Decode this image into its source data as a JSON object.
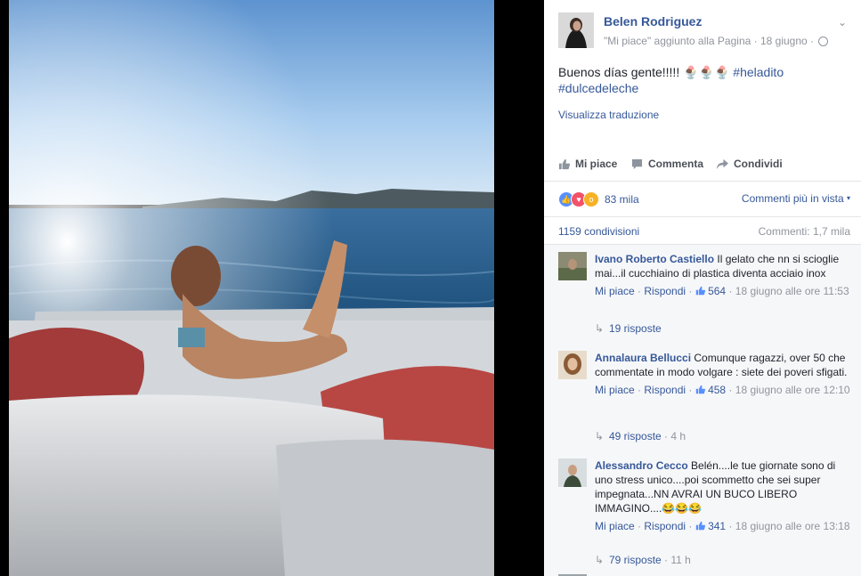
{
  "post": {
    "author": "Belen Rodriguez",
    "meta": "\"Mi piace\" aggiunto alla Pagina · 18 giugno ·",
    "text": "Buenos días gente!!!!! 🍨🍨🍨 ",
    "hashtag1": "#heladito",
    "hashtag2": "#dulcedeleche",
    "translate": "Visualizza traduzione"
  },
  "actions": {
    "like": "Mi piace",
    "comment": "Commenta",
    "share": "Condividi"
  },
  "stats": {
    "reactions_count": "83 mila",
    "sort": "Commenti più in vista",
    "shares": "1159 condivisioni",
    "comments": "Commenti: 1,7 mila"
  },
  "comments": [
    {
      "name": "Ivano Roberto Castiello",
      "text": " Il gelato che nn si scioglie mai...il cucchiaino di plastica diventa acciaio inox",
      "like": "Mi piace",
      "reply": "Rispondi",
      "likes": "564",
      "time": " · 18 giugno alle ore 11:53",
      "replies": "19 risposte",
      "replies_time": ""
    },
    {
      "name": "Annalaura Bellucci",
      "text": " Comunque ragazzi, over 50 che commentate in modo volgare : siete dei poveri sfigati.",
      "like": "Mi piace",
      "reply": "Rispondi",
      "likes": "458",
      "time": " · 18 giugno alle ore 12:10",
      "replies": "49 risposte",
      "replies_time": " · 4 h"
    },
    {
      "name": "Alessandro Cecco",
      "text": " Belén....le tue giornate sono di uno stress unico....poi scommetto che sei super impegnata...NN AVRAI UN BUCO LIBERO IMMAGINO....😂😂😂",
      "like": "Mi piace",
      "reply": "Rispondi",
      "likes": "341",
      "time": " · 18 giugno alle ore 13:18",
      "replies": "79 risposte",
      "replies_time": " · 11 h"
    }
  ],
  "colors": {
    "link": "#365899",
    "muted": "#90949c",
    "sea": "#1f5f90",
    "sky": "#9fc6ea"
  }
}
